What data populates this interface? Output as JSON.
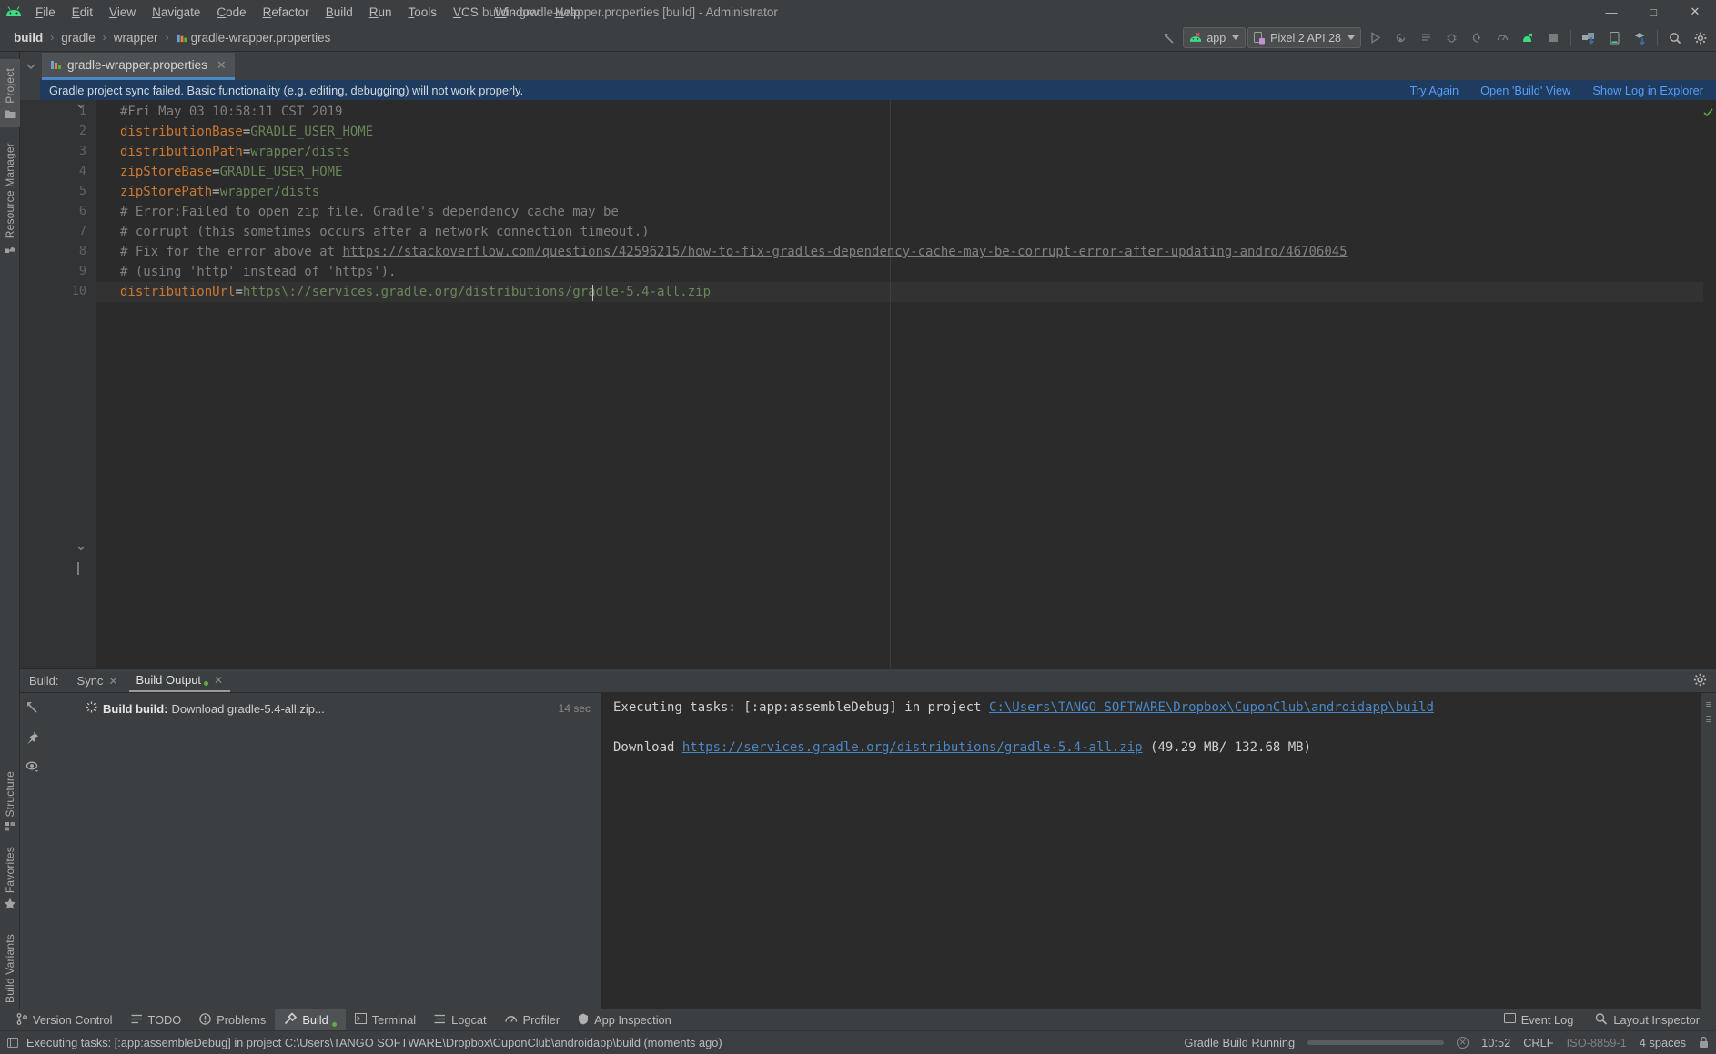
{
  "window": {
    "title": "build - gradle-wrapper.properties [build] - Administrator",
    "minimize": "—",
    "maximize": "□",
    "close": "✕"
  },
  "menubar": {
    "items": [
      {
        "label": "File"
      },
      {
        "label": "Edit"
      },
      {
        "label": "View"
      },
      {
        "label": "Navigate"
      },
      {
        "label": "Code"
      },
      {
        "label": "Refactor"
      },
      {
        "label": "Build"
      },
      {
        "label": "Run"
      },
      {
        "label": "Tools"
      },
      {
        "label": "VCS"
      },
      {
        "label": "Window"
      },
      {
        "label": "Help"
      }
    ]
  },
  "breadcrumb": {
    "separator": "›",
    "items": [
      {
        "label": "build",
        "bold": true
      },
      {
        "label": "gradle",
        "bold": false
      },
      {
        "label": "wrapper",
        "bold": false
      },
      {
        "label": "gradle-wrapper.properties",
        "bold": false,
        "icon": "properties-file-icon"
      }
    ]
  },
  "toolbar": {
    "back_arrow": "back-arrow-icon",
    "run_config": "app",
    "device": "Pixel 2 API 28",
    "buttons": [
      {
        "name": "run-button",
        "glyph": "▶"
      },
      {
        "name": "run-coverage-button",
        "glyph": "↻"
      },
      {
        "name": "apply-changes-button",
        "glyph": "≡"
      },
      {
        "name": "debug-button",
        "glyph": "✱"
      },
      {
        "name": "attach-debugger-button",
        "glyph": "◖"
      },
      {
        "name": "profiler-button",
        "glyph": "∴"
      },
      {
        "name": "sync-gradle-button",
        "glyph": "⬡"
      },
      {
        "name": "stop-button",
        "glyph": "■"
      },
      {
        "name": "sdk-manager-button",
        "glyph": "◈"
      },
      {
        "name": "avd-manager-button",
        "glyph": "▭"
      },
      {
        "name": "layout-inspector-button",
        "glyph": "▣"
      },
      {
        "name": "search-everywhere-button",
        "glyph": "⌕"
      },
      {
        "name": "settings-button",
        "glyph": "⚙"
      }
    ]
  },
  "left_tool_strip": {
    "top_items": [
      {
        "label": "Project",
        "icon": "folder-icon",
        "active": true
      },
      {
        "label": "Resource Manager",
        "icon": "resource-icon",
        "active": false
      }
    ],
    "bottom_items": [
      {
        "label": "Structure",
        "icon": "structure-icon",
        "active": false
      },
      {
        "label": "Favorites",
        "icon": "star-icon",
        "active": false
      },
      {
        "label": "Build Variants",
        "icon": "android-icon",
        "active": false
      }
    ]
  },
  "editor_tabs": [
    {
      "label": "gradle-wrapper.properties",
      "icon": "properties-file-icon",
      "close": "✕",
      "active": true
    }
  ],
  "banner": {
    "message": "Gradle project sync failed. Basic functionality (e.g. editing, debugging) will not work properly.",
    "links": [
      "Try Again",
      "Open 'Build' View",
      "Show Log in Explorer"
    ]
  },
  "editor": {
    "lines": [
      {
        "no": "1",
        "segments": [
          {
            "t": "#Fri May 03 10:58:11 CST 2019",
            "c": "comment"
          }
        ]
      },
      {
        "no": "2",
        "segments": [
          {
            "t": "distributionBase",
            "c": "prop-key"
          },
          {
            "t": "=",
            "c": "plain"
          },
          {
            "t": "GRADLE_USER_HOME",
            "c": "prop-val"
          }
        ]
      },
      {
        "no": "3",
        "segments": [
          {
            "t": "distributionPath",
            "c": "prop-key"
          },
          {
            "t": "=",
            "c": "plain"
          },
          {
            "t": "wrapper/dists",
            "c": "prop-val"
          }
        ]
      },
      {
        "no": "4",
        "segments": [
          {
            "t": "zipStoreBase",
            "c": "prop-key"
          },
          {
            "t": "=",
            "c": "plain"
          },
          {
            "t": "GRADLE_USER_HOME",
            "c": "prop-val"
          }
        ]
      },
      {
        "no": "5",
        "segments": [
          {
            "t": "zipStorePath",
            "c": "prop-key"
          },
          {
            "t": "=",
            "c": "plain"
          },
          {
            "t": "wrapper/dists",
            "c": "prop-val"
          }
        ]
      },
      {
        "no": "6",
        "segments": [
          {
            "t": "# Error:Failed to open zip file. Gradle's dependency cache may be",
            "c": "comment"
          }
        ]
      },
      {
        "no": "7",
        "segments": [
          {
            "t": "# corrupt (this sometimes occurs after a network connection timeout.)",
            "c": "comment"
          }
        ]
      },
      {
        "no": "8",
        "segments": [
          {
            "t": "# Fix for the error above at ",
            "c": "comment"
          },
          {
            "t": "https://stackoverflow.com/questions/42596215/how-to-fix-gradles-dependency-cache-may-be-corrupt-error-after-updating-andro/46706045",
            "c": "clink"
          }
        ]
      },
      {
        "no": "9",
        "segments": [
          {
            "t": "# (using 'http' instead of 'https').",
            "c": "comment"
          }
        ]
      },
      {
        "no": "10",
        "segments": [
          {
            "t": "distributionUrl",
            "c": "prop-key"
          },
          {
            "t": "=",
            "c": "plain"
          },
          {
            "t": "https\\://services.gradle.org/distributions/gradle-5.4-all.zip",
            "c": "prop-val"
          }
        ]
      }
    ],
    "caret_line": 10
  },
  "build_window": {
    "label": "Build:",
    "tabs": [
      {
        "label": "Sync",
        "close": "✕",
        "active": false,
        "dot": false
      },
      {
        "label": "Build Output",
        "close": "✕",
        "active": true,
        "dot": true
      }
    ],
    "settings_icon": "gear-icon",
    "side_icons": [
      {
        "name": "collapse-arrow-icon",
        "glyph": "↖"
      },
      {
        "name": "pin-icon",
        "glyph": "⚑"
      },
      {
        "name": "eye-icon",
        "glyph": "◉"
      }
    ],
    "tree": [
      {
        "icon": "spinner-icon",
        "bold_text": "Build build:",
        "text": " Download gradle-5.4-all.zip...",
        "duration": "14 sec"
      }
    ],
    "console": [
      {
        "parts": [
          {
            "t": "Executing tasks: [:app:assembleDebug] in project ",
            "link": false
          },
          {
            "t": "C:\\Users\\TANGO SOFTWARE\\Dropbox\\CuponClub\\androidapp\\build",
            "link": true
          }
        ]
      },
      {
        "parts": []
      },
      {
        "parts": [
          {
            "t": "Download ",
            "link": false
          },
          {
            "t": "https://services.gradle.org/distributions/gradle-5.4-all.zip",
            "link": true
          },
          {
            "t": " (49.29 MB/ 132.68 MB)",
            "link": false
          }
        ]
      }
    ]
  },
  "bottom_strip": {
    "items": [
      {
        "label": "Version Control",
        "icon": "branch-icon",
        "active": false
      },
      {
        "label": "TODO",
        "icon": "list-icon",
        "active": false
      },
      {
        "label": "Problems",
        "icon": "exclamation-icon",
        "active": false
      },
      {
        "label": "Build",
        "icon": "hammer-icon",
        "active": true,
        "dot": true
      },
      {
        "label": "Terminal",
        "icon": "terminal-icon",
        "active": false
      },
      {
        "label": "Logcat",
        "icon": "logcat-icon",
        "active": false
      },
      {
        "label": "Profiler",
        "icon": "profiler-icon",
        "active": false
      },
      {
        "label": "App Inspection",
        "icon": "inspection-icon",
        "active": false
      }
    ],
    "right_items": [
      {
        "label": "Event Log",
        "icon": "event-log-icon"
      },
      {
        "label": "Layout Inspector",
        "icon": "layout-inspector-icon"
      }
    ]
  },
  "statusbar": {
    "icon": "status-window-icon",
    "message": "Executing tasks: [:app:assembleDebug] in project C:\\Users\\TANGO SOFTWARE\\Dropbox\\CuponClub\\androidapp\\build (moments ago)",
    "progress_label": "Gradle Build Running",
    "progress_cancel": "✕",
    "caret_position": "10:52",
    "line_separator": "CRLF",
    "encoding": "ISO-8859-1",
    "indent": "4 spaces",
    "lock_icon": "lock-icon"
  },
  "colors": {
    "chrome": "#3c3f41",
    "editor_bg": "#2b2b2b",
    "banner_bg": "#1f3b5e",
    "link": "#589df6",
    "accent_tab": "#4a88c7",
    "key": "#cc7832",
    "value": "#6a8759",
    "comment": "#808080",
    "android_green": "#3ddc84"
  }
}
